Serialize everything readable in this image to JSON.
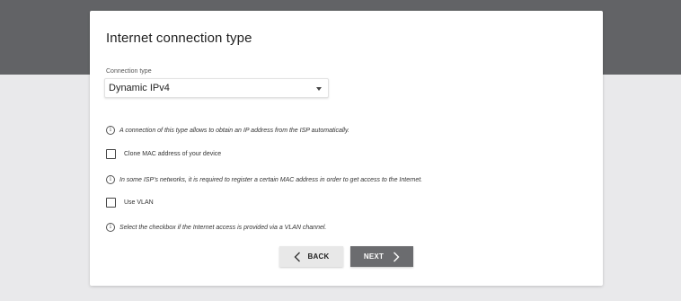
{
  "page": {
    "title": "Internet connection type"
  },
  "connection": {
    "label": "Connection type",
    "selected": "Dynamic IPv4"
  },
  "info": {
    "type_hint": "A connection of this type allows to obtain an IP address from the ISP automatically.",
    "mac_hint": "In some ISP's networks, it is required to register a certain MAC address in order to get access to the Internet.",
    "vlan_hint": "Select the checkbox if the Internet access is provided via a VLAN channel."
  },
  "options": {
    "clone_mac_label": "Clone MAC address of your device",
    "clone_mac_checked": false,
    "use_vlan_label": "Use VLAN",
    "use_vlan_checked": false
  },
  "buttons": {
    "back_label": "BACK",
    "next_label": "NEXT"
  },
  "icons": {
    "info": "info-icon",
    "dropdown": "caret-down-icon",
    "back": "chevron-left-icon",
    "next": "chevron-right-icon"
  },
  "colors": {
    "header_band": "#626366",
    "page_background": "#e9e9eb",
    "next_button": "#6b6c6f",
    "back_button": "#e8e8e8"
  }
}
